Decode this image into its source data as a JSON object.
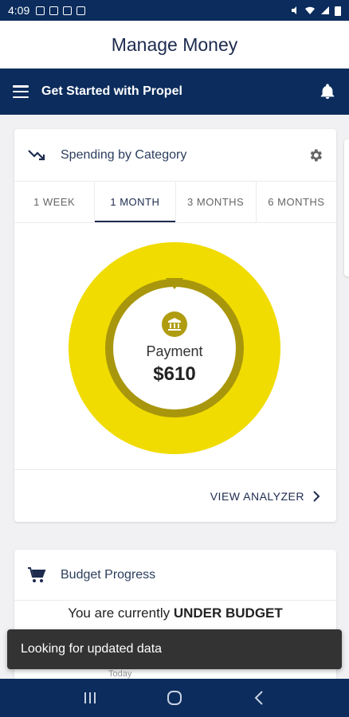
{
  "status_bar": {
    "time": "4:09"
  },
  "header": {
    "title": "Manage Money"
  },
  "nav": {
    "title": "Get Started with Propel"
  },
  "spending": {
    "title": "Spending by Category",
    "tabs": [
      {
        "label": "1 WEEK"
      },
      {
        "label": "1 MONTH"
      },
      {
        "label": "3 MONTHS"
      },
      {
        "label": "6 MONTHS"
      }
    ],
    "active_tab": 1,
    "center_label": "Payment",
    "center_value": "$610",
    "view_analyzer": "VIEW ANALYZER",
    "colors": {
      "donut": "#f0dc00",
      "ring": "#a8960c"
    }
  },
  "budget": {
    "title": "Budget Progress",
    "status_prefix": "You are currently",
    "status_emphasis": "UNDER BUDGET",
    "today_label": "Today"
  },
  "snackbar": {
    "message": "Looking for updated data"
  },
  "colors": {
    "primary": "#0b2c5c",
    "accent": "#f0dc00"
  }
}
